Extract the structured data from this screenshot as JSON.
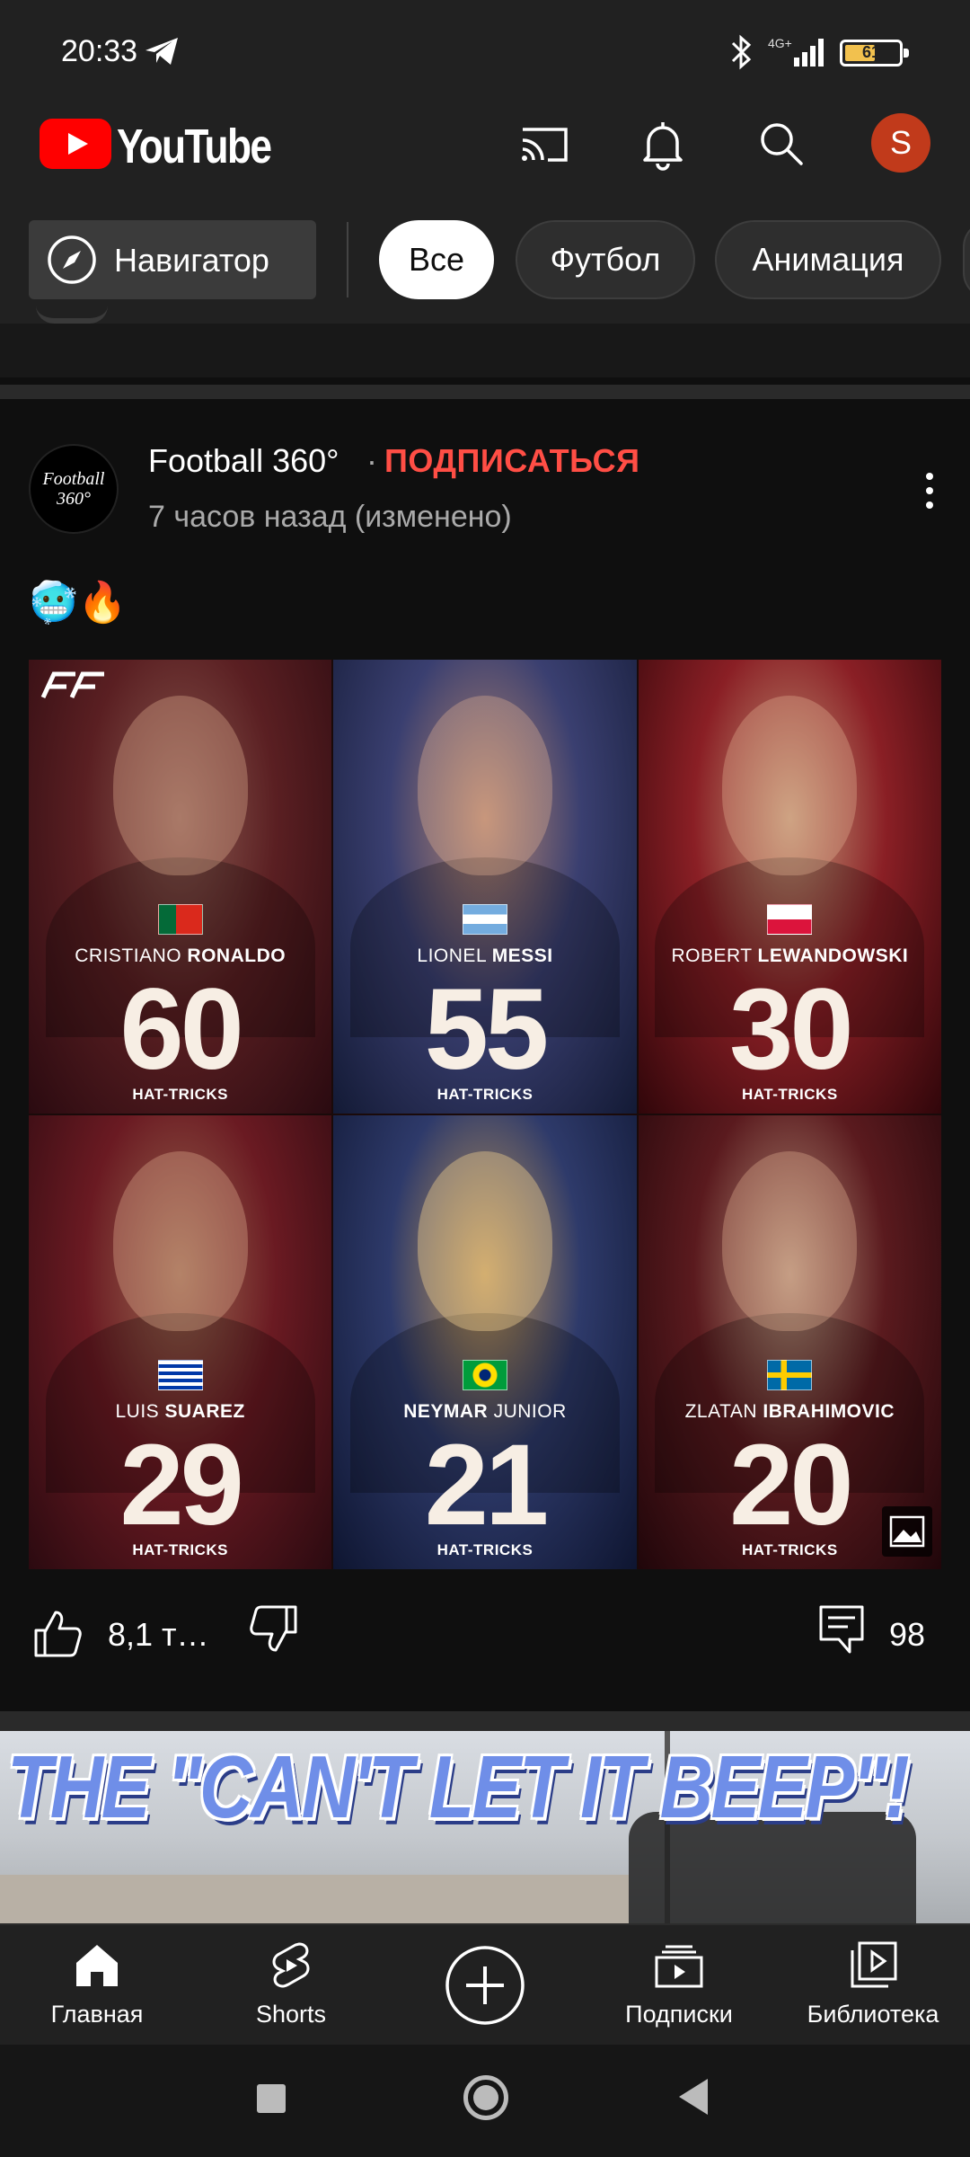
{
  "status_bar": {
    "time": "20:33",
    "network": "4G+",
    "battery": "61",
    "battery_level": 0.61,
    "icons": [
      "telegram-icon",
      "bluetooth-icon",
      "signal-icon",
      "battery-icon"
    ]
  },
  "header": {
    "logo_text": "YouTube",
    "avatar_letter": "S",
    "icons": [
      "cast-icon",
      "bell-icon",
      "search-icon"
    ],
    "brand_color": "#ff0000",
    "avatar_color": "#c13a1b"
  },
  "chips": {
    "explore": "Навигатор",
    "items": [
      {
        "label": "Все",
        "active": true
      },
      {
        "label": "Футбол",
        "active": false
      },
      {
        "label": "Анимация",
        "active": false
      }
    ]
  },
  "post": {
    "channel_avatar_text": "Football 360°",
    "channel": "Football 360°",
    "separator": "·",
    "subscribe": "ПОДПИСАТЬСЯ",
    "time": "7 часов назад (изменено)",
    "text": "🥶🔥",
    "players": [
      {
        "first": "CRISTIANO",
        "last": "RONALDO",
        "number": "60",
        "caption": "HAT-TRICKS",
        "flag": "portugal"
      },
      {
        "first": "LIONEL",
        "last": "MESSI",
        "number": "55",
        "caption": "HAT-TRICKS",
        "flag": "argentina"
      },
      {
        "first": "ROBERT",
        "last": "LEWANDOWSKI",
        "number": "30",
        "caption": "HAT-TRICKS",
        "flag": "poland"
      },
      {
        "first": "LUIS",
        "last": "SUAREZ",
        "number": "29",
        "caption": "HAT-TRICKS",
        "flag": "uruguay"
      },
      {
        "first": "NEYMAR",
        "last": "JUNIOR",
        "number": "21",
        "caption": "HAT-TRICKS",
        "flag": "brazil"
      },
      {
        "first": "ZLATAN",
        "last": "IBRAHIMOVIC",
        "number": "20",
        "caption": "HAT-TRICKS",
        "flag": "sweden"
      }
    ],
    "likes": "8,1 т…",
    "comments": "98",
    "subscribe_color": "#ff4e45"
  },
  "next_video": {
    "thumbnail_text": "THE \"CAN'T LET IT BEEP\"!"
  },
  "bottom_nav": {
    "items": [
      {
        "label": "Главная",
        "icon": "home-icon"
      },
      {
        "label": "Shorts",
        "icon": "shorts-icon"
      },
      {
        "label": "",
        "icon": "create-icon"
      },
      {
        "label": "Подписки",
        "icon": "subscriptions-icon"
      },
      {
        "label": "Библиотека",
        "icon": "library-icon"
      }
    ]
  }
}
